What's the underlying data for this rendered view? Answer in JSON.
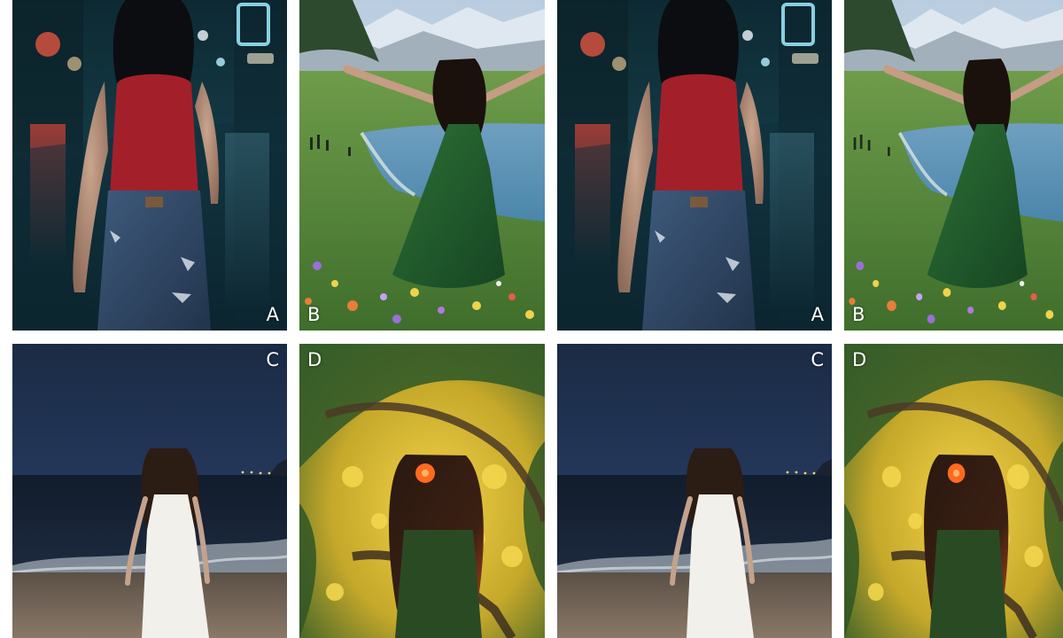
{
  "panels": [
    {
      "label": "A",
      "scene": "rainy-night-street"
    },
    {
      "label": "B",
      "scene": "meadow-lake"
    },
    {
      "label": "A",
      "scene": "rainy-night-street"
    },
    {
      "label": "B",
      "scene": "meadow-lake"
    },
    {
      "label": "C",
      "scene": "night-beach"
    },
    {
      "label": "D",
      "scene": "painted-tree"
    },
    {
      "label": "C",
      "scene": "night-beach"
    },
    {
      "label": "D",
      "scene": "painted-tree"
    }
  ],
  "colors": {
    "background": "#ffffff",
    "label": "#ffffff",
    "red_top": "#a3202a",
    "green_dress": "#1f5a2b",
    "white_dress": "#f2f0ea"
  }
}
